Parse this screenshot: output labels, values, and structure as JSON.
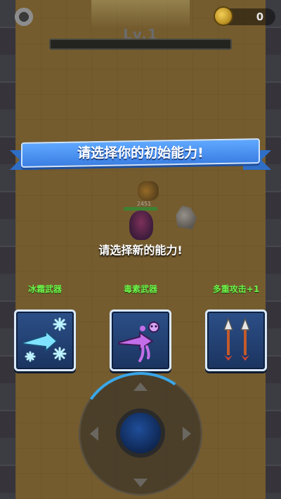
{
  "hud": {
    "level": "Lv.1",
    "coins": "0",
    "settings_icon": "gear-icon",
    "coin_icon": "coin-icon"
  },
  "banner": {
    "title": "请选择你的初始能力!"
  },
  "prompt": "请选择新的能力!",
  "options": [
    {
      "label": "冰霜武器",
      "icon": "frost-weapon-icon"
    },
    {
      "label": "毒素武器",
      "icon": "poison-weapon-icon"
    },
    {
      "label": "多重攻击+1",
      "icon": "multishot-arrows-icon"
    }
  ],
  "player_hp": "2451",
  "colors": {
    "label_green": "#6ff04a",
    "ribbon_blue": "#3b7fe3",
    "card_blue": "#2c4f88"
  }
}
